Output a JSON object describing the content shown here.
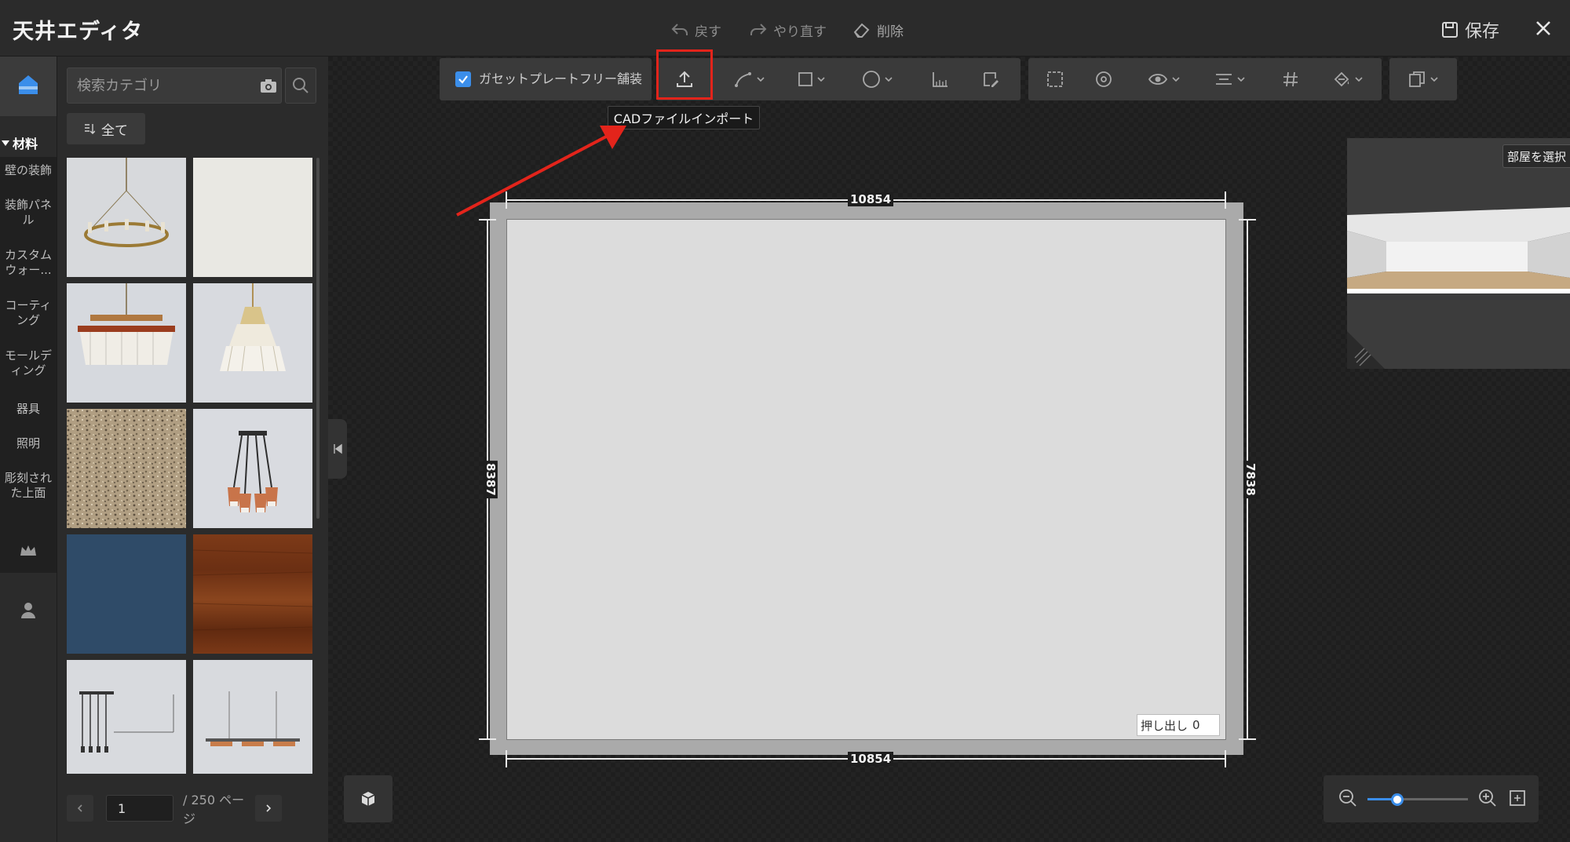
{
  "app": {
    "title": "天井エディタ"
  },
  "header": {
    "undo_label": "戻す",
    "redo_label": "やり直す",
    "delete_label": "削除",
    "save_label": "保存"
  },
  "rail": {
    "category_header": "材料",
    "sub_items": [
      "壁の装飾",
      "装飾パネル",
      "カスタムウォー...",
      "コーティング",
      "モールディング",
      "器具",
      "照明",
      "彫刻された上面"
    ],
    "icons": [
      "home-icon",
      "crown-icon",
      "user-icon"
    ]
  },
  "panel": {
    "search_placeholder": "検索カテゴリ",
    "filter_label": "全て",
    "thumbnails": [
      "ring-chandelier",
      "plain-white-panel",
      "crystal-linear-chandelier",
      "crystal-tiered-chandelier",
      "speckled-granite",
      "copper-pendant-cluster",
      "navy-blue-panel",
      "walnut-wood",
      "drop-pendant-bar",
      "linear-suspension-light"
    ],
    "pager": {
      "current_page": "1",
      "total_label": "/ 250 ページ"
    }
  },
  "toolbar": {
    "gusset_label": "ガセットプレートフリー舗装",
    "gusset_checked": true,
    "cad_tooltip": "CADファイルインポート"
  },
  "plan": {
    "dim_top": "10854",
    "dim_bottom": "10854",
    "dim_left": "8387",
    "dim_right": "7838",
    "extrude_label": "押し出し",
    "extrude_value": "0"
  },
  "preview": {
    "room_select_label": "部屋を選択"
  },
  "zoom": {
    "level": 0.3
  },
  "colors": {
    "accent": "#3b8eea",
    "highlight": "#e3241b",
    "background": "#1e1e1e",
    "panel": "#2b2b2b"
  }
}
